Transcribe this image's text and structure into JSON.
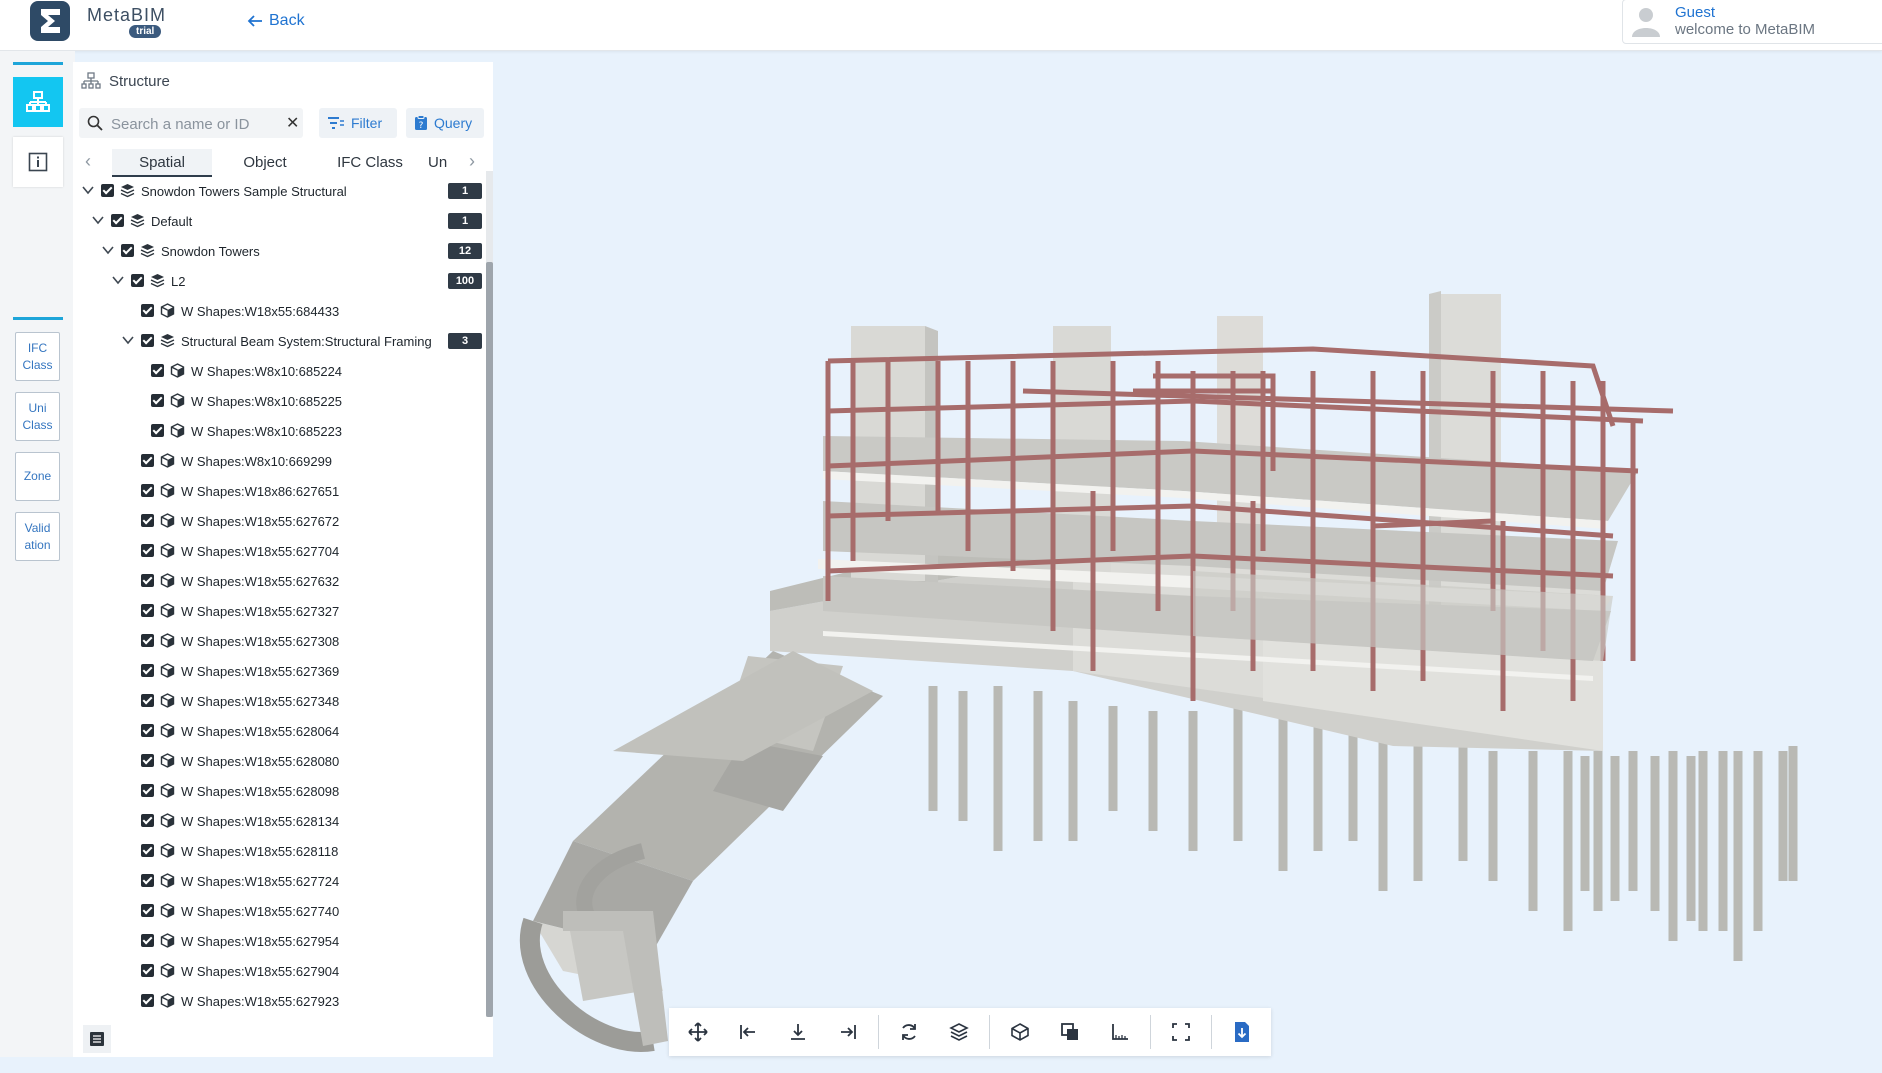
{
  "app": {
    "name": "MetaBIM",
    "badge": "trial"
  },
  "header": {
    "back_label": "Back"
  },
  "user": {
    "name": "Guest",
    "welcome": "welcome to MetaBIM"
  },
  "rail": {
    "buttons": [
      "structure-icon",
      "info-icon"
    ],
    "tabs": [
      {
        "line1": "IFC",
        "line2": "Class"
      },
      {
        "line1": "Uni",
        "line2": "Class"
      },
      {
        "line1": "Zone",
        "line2": ""
      },
      {
        "line1": "Valid",
        "line2": "ation"
      }
    ]
  },
  "panel": {
    "title": "Structure",
    "search_placeholder": "Search a name or ID",
    "filter_label": "Filter",
    "query_label": "Query",
    "tabs": [
      "Spatial",
      "Object",
      "IFC Class",
      "Un"
    ],
    "active_tab": "Spatial"
  },
  "tree": [
    {
      "level": 0,
      "expanded": true,
      "type": "layers",
      "label": "Snowdon Towers Sample Structural",
      "count": "1"
    },
    {
      "level": 1,
      "expanded": true,
      "type": "layers",
      "label": "Default",
      "count": "1"
    },
    {
      "level": 2,
      "expanded": true,
      "type": "layers",
      "label": "Snowdon Towers",
      "count": "12"
    },
    {
      "level": 3,
      "expanded": true,
      "type": "layers",
      "label": "L2",
      "count": "100"
    },
    {
      "level": 4,
      "type": "cube",
      "label": "W Shapes:W18x55:684433"
    },
    {
      "level": 4,
      "expanded": true,
      "type": "layers",
      "label": "Structural Beam System:Structural Framing",
      "count": "3"
    },
    {
      "level": 5,
      "type": "cube",
      "label": "W Shapes:W8x10:685224"
    },
    {
      "level": 5,
      "type": "cube",
      "label": "W Shapes:W8x10:685225"
    },
    {
      "level": 5,
      "type": "cube",
      "label": "W Shapes:W8x10:685223"
    },
    {
      "level": 4,
      "type": "cube",
      "label": "W Shapes:W8x10:669299"
    },
    {
      "level": 4,
      "type": "cube",
      "label": "W Shapes:W18x86:627651"
    },
    {
      "level": 4,
      "type": "cube",
      "label": "W Shapes:W18x55:627672"
    },
    {
      "level": 4,
      "type": "cube",
      "label": "W Shapes:W18x55:627704"
    },
    {
      "level": 4,
      "type": "cube",
      "label": "W Shapes:W18x55:627632"
    },
    {
      "level": 4,
      "type": "cube",
      "label": "W Shapes:W18x55:627327"
    },
    {
      "level": 4,
      "type": "cube",
      "label": "W Shapes:W18x55:627308"
    },
    {
      "level": 4,
      "type": "cube",
      "label": "W Shapes:W18x55:627369"
    },
    {
      "level": 4,
      "type": "cube",
      "label": "W Shapes:W18x55:627348"
    },
    {
      "level": 4,
      "type": "cube",
      "label": "W Shapes:W18x55:628064"
    },
    {
      "level": 4,
      "type": "cube",
      "label": "W Shapes:W18x55:628080"
    },
    {
      "level": 4,
      "type": "cube",
      "label": "W Shapes:W18x55:628098"
    },
    {
      "level": 4,
      "type": "cube",
      "label": "W Shapes:W18x55:628134"
    },
    {
      "level": 4,
      "type": "cube",
      "label": "W Shapes:W18x55:628118"
    },
    {
      "level": 4,
      "type": "cube",
      "label": "W Shapes:W18x55:627724"
    },
    {
      "level": 4,
      "type": "cube",
      "label": "W Shapes:W18x55:627740"
    },
    {
      "level": 4,
      "type": "cube",
      "label": "W Shapes:W18x55:627954"
    },
    {
      "level": 4,
      "type": "cube",
      "label": "W Shapes:W18x55:627904"
    },
    {
      "level": 4,
      "type": "cube",
      "label": "W Shapes:W18x55:627923"
    }
  ],
  "toolbar": {
    "groups": [
      [
        "move-icon",
        "step-back-icon",
        "download-arrow-icon",
        "step-forward-icon"
      ],
      [
        "refresh-icon",
        "layers-icon"
      ],
      [
        "cube-outline-icon",
        "overlap-icon",
        "measure-icon"
      ],
      [
        "section-box-icon"
      ],
      [
        "export-file-icon"
      ]
    ]
  },
  "colors": {
    "accent": "#13c6f1",
    "link": "#1f73d1",
    "viewport_bg": "#e8f2fc",
    "beam": "#a9706f",
    "concrete": "#cfcfcb"
  }
}
